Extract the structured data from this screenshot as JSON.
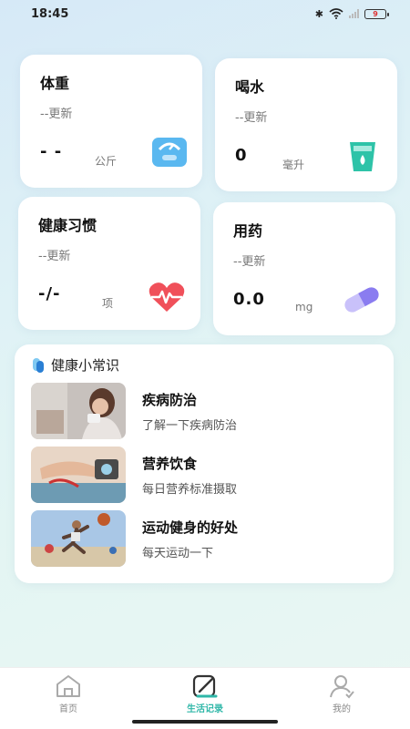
{
  "status": {
    "time": "18:45",
    "battery": "9"
  },
  "cards": {
    "weight": {
      "title": "体重",
      "updated": "--更新",
      "value": "- -",
      "unit": "公斤"
    },
    "water": {
      "title": "喝水",
      "updated": "--更新",
      "value": "0",
      "unit": "毫升"
    },
    "habits": {
      "title": "健康习惯",
      "updated": "--更新",
      "value": "-/-",
      "unit": "项"
    },
    "medicine": {
      "title": "用药",
      "updated": "--更新",
      "value": "0.0",
      "unit": "mg"
    }
  },
  "tips": {
    "title": "健康小常识",
    "items": [
      {
        "name": "疾病防治",
        "desc": "了解一下疾病防治"
      },
      {
        "name": "营养饮食",
        "desc": "每日营养标准摄取"
      },
      {
        "name": "运动健身的好处",
        "desc": "每天运动一下"
      }
    ]
  },
  "nav": {
    "home": "首页",
    "records": "生活记录",
    "mine": "我的"
  },
  "colors": {
    "accent": "#2fb7a8",
    "water_icon": "#2ec3a8",
    "heart_icon": "#f0505a",
    "pill_icon": "#8a7cf0",
    "scale_icon": "#5ab8f0"
  }
}
